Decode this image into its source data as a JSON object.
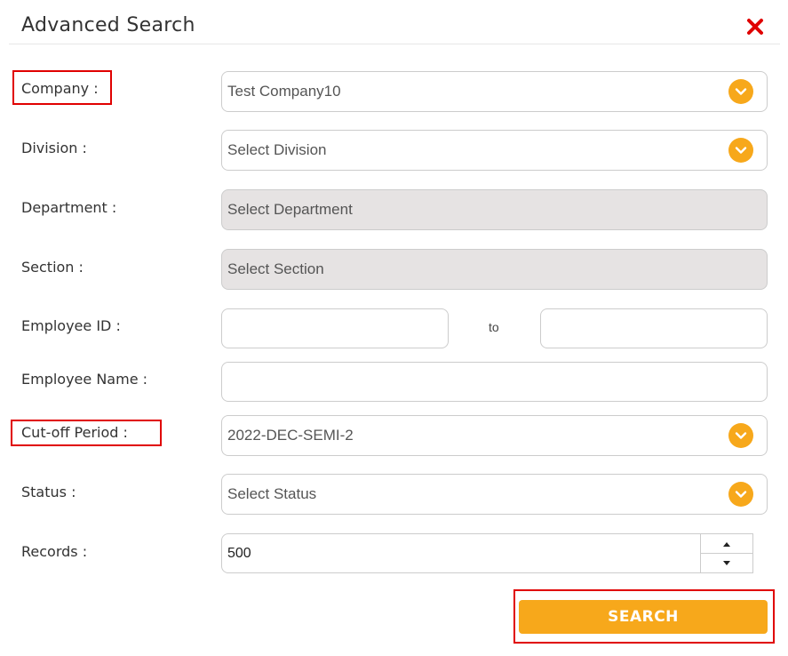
{
  "dialog": {
    "title": "Advanced Search",
    "close_icon": "close-x-icon"
  },
  "fields": {
    "company": {
      "label": "Company :",
      "value": "Test Company10"
    },
    "division": {
      "label": "Division :",
      "placeholder": "Select Division"
    },
    "department": {
      "label": "Department :",
      "placeholder": "Select Department"
    },
    "section": {
      "label": "Section :",
      "placeholder": "Select Section"
    },
    "employee_id": {
      "label": "Employee ID :",
      "from_value": "",
      "to_label": "to",
      "to_value": ""
    },
    "employee_name": {
      "label": "Employee Name :",
      "value": ""
    },
    "cutoff_period": {
      "label": "Cut-off Period :",
      "value": "2022-DEC-SEMI-2"
    },
    "status": {
      "label": "Status :",
      "placeholder": "Select Status"
    },
    "records": {
      "label": "Records :",
      "value": "500"
    }
  },
  "actions": {
    "search_label": "SEARCH"
  },
  "colors": {
    "accent": "#f7a81b",
    "highlight": "#e00000",
    "close": "#e00000",
    "disabled_bg": "#e6e3e3"
  }
}
